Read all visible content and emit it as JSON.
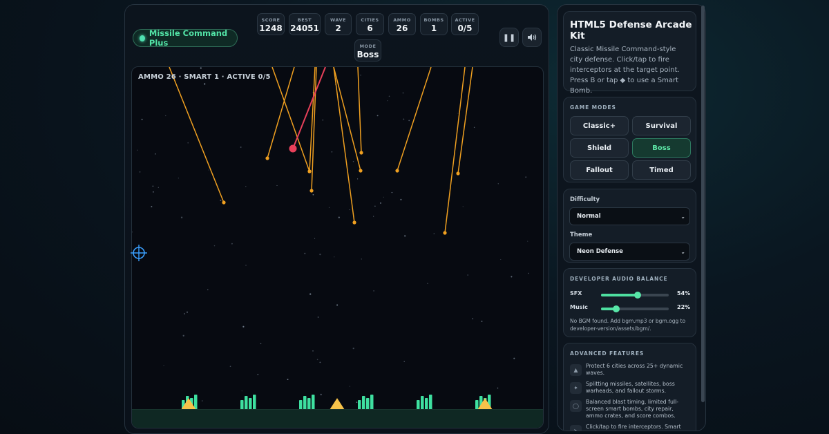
{
  "header": {
    "app_title": "Missile Command Plus",
    "stats": [
      {
        "label": "SCORE",
        "value": "1248"
      },
      {
        "label": "BEST",
        "value": "24051"
      },
      {
        "label": "WAVE",
        "value": "2"
      },
      {
        "label": "CITIES",
        "value": "6"
      },
      {
        "label": "AMMO",
        "value": "26"
      },
      {
        "label": "BOMBS",
        "value": "1"
      },
      {
        "label": "ACTIVE",
        "value": "0/5"
      },
      {
        "label": "MODE",
        "value": "Boss"
      }
    ],
    "pause_icon": "pause-icon",
    "sound_icon": "speaker-icon"
  },
  "arena": {
    "hud": "AMMO 26 · SMART 1 · ACTIVE 0/5",
    "colors": {
      "missile": "#f0a020",
      "boss": "#e8405a",
      "city": "#3ee0a0",
      "silo": "#f6c24a",
      "crosshair": "#3aa0ff"
    }
  },
  "sidebar": {
    "intro": {
      "title": "HTML5 Defense Arcade Kit",
      "description": "Classic Missile Command-style city defense. Click/tap to fire interceptors at the target point. Press B or tap ◆ to use a Smart Bomb."
    },
    "modes": {
      "heading": "GAME MODES",
      "items": [
        "Classic+",
        "Survival",
        "Shield",
        "Boss",
        "Fallout",
        "Timed"
      ],
      "active": "Boss"
    },
    "settings": {
      "difficulty_label": "Difficulty",
      "difficulty_value": "Normal",
      "theme_label": "Theme",
      "theme_value": "Neon Defense"
    },
    "audio": {
      "heading": "DEVELOPER AUDIO BALANCE",
      "sfx_label": "SFX",
      "sfx_value": "54%",
      "sfx_level": 0.54,
      "music_label": "Music",
      "music_value": "22%",
      "music_level": 0.22,
      "note": "No BGM found. Add bgm.mp3 or bgm.ogg to developer-version/assets/bgm/."
    },
    "features": {
      "heading": "ADVANCED FEATURES",
      "items": [
        "Protect 6 cities across 25+ dynamic waves.",
        "Splitting missiles, satellites, boss warheads, and fallout storms.",
        "Balanced blast timing, limited full-screen smart bombs, city repair, ammo crates, and score combos.",
        "Click/tap to fire interceptors. Smart Bomb triggers a full-screen"
      ]
    }
  }
}
